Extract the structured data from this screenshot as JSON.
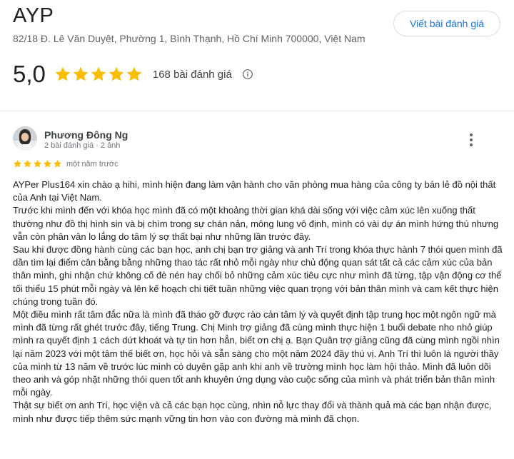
{
  "business": {
    "name": "AYP",
    "address": "82/18 Đ. Lê Văn Duyệt, Phường 1, Bình Thạnh, Hồ Chí Minh 700000, Việt Nam",
    "write_review_label": "Viết bài đánh giá"
  },
  "rating": {
    "value": "5,0",
    "stars": 5,
    "count_label": "168 bài đánh giá",
    "star_color": "#fbbc04"
  },
  "review": {
    "reviewer_name": "Phương Đông Ng",
    "reviewer_meta": "2 bài đánh giá · 2 ảnh",
    "stars": 5,
    "time": "một năm trước",
    "paragraphs": [
      "AYPer Plus164 xin chào ạ hihi, mình hiện đang làm vận hành cho văn phòng mua hàng của công ty bán lẻ đồ nội thất của Anh tại Việt Nam.",
      "Trước khi mình đến với khóa học mình đã có một khoảng thời gian khá dài sống với việc cảm xúc lên xuống thất thường như đồ thị hình sin và bị chìm trong sự chán nản, mông lung vô định, mình có vài dự án mình hứng thú nhưng vẫn còn phân vân lo lắng do tâm lý sợ thất bại như những lần trước đây.",
      "Sau khi được đồng hành cùng các bạn học, anh chị bạn trợ giảng và anh Trí trong khóa thực hành 7 thói quen mình đã dần tìm lại điểm cân bằng bằng những thao tác rất nhỏ mỗi ngày như chủ động quan sát tất cả các cảm xúc của bản thân mình, ghi nhận chứ không cố đè nén hay chối bỏ những cảm xúc tiêu cực như mình đã từng, tập vận động cơ thể tối thiểu 15 phút mỗi ngày và lên kế hoạch chi tiết tuần những việc quan trọng với bản thân mình và cam kết thực hiện chúng trong tuần đó.",
      "Một điều mình rất tâm đắc nữa là mình đã tháo gỡ được rào cản tâm lý và quyết định tập trung học một ngôn ngữ mà mình đã từng rất ghét trước đây, tiếng Trung. Chị Minh trợ giảng đã cùng mình thực hiện 1 buổi debate nho nhỏ giúp mình ra quyết định 1 cách dứt khoát và tự tin hơn hẳn, biết ơn chị ạ. Bạn Quân trợ giảng cũng đã cùng mình ngồi nhìn lại năm 2023 với một tâm thế biết ơn, học hỏi và sẵn sàng cho một năm 2024 đầy thú vị. Anh Trí thì luôn là người thầy của mình từ 13 năm về trước lúc mình có duyên gặp anh khi anh về trường mình học làm hội thảo. Mình đã luôn dõi theo anh và góp nhặt những thói quen tốt anh khuyên ứng dụng vào cuộc sống của mình và phát triển bản thân mình mỗi ngày.",
      "Thật sự biết ơn anh Trí, học viện và cả các bạn học cùng, nhìn nỗ lực thay đổi và thành quả mà các bạn nhận được, mình như được tiếp thêm sức mạnh vững tin hơn vào con đường mà mình đã chọn."
    ]
  },
  "icons": {
    "star": "star-icon",
    "info": "info-icon",
    "more": "more-vert-icon",
    "avatar": "avatar-photo"
  },
  "colors": {
    "accent": "#1a73e8",
    "star": "#fbbc04",
    "text": "#202124",
    "muted": "#70757a"
  }
}
